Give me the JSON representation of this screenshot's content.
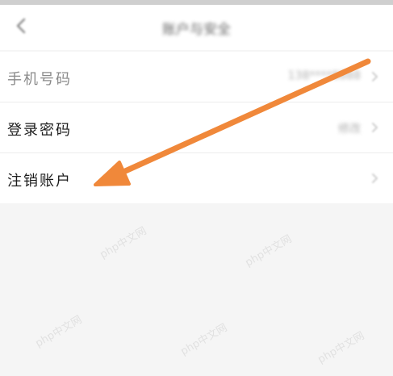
{
  "header": {
    "title": "账户与安全",
    "back_icon": "chevron-left-icon"
  },
  "settings": {
    "items": [
      {
        "label": "手机号码",
        "value": "138****8888"
      },
      {
        "label": "登录密码",
        "value": "修改"
      },
      {
        "label": "注销账户",
        "value": ""
      }
    ]
  },
  "annotation": {
    "arrow_color": "#f0883a",
    "watermark": "php中文网"
  },
  "colors": {
    "background": "#f5f5f5",
    "surface": "#ffffff",
    "text_primary": "#1c1c1c",
    "text_secondary": "#999999"
  }
}
